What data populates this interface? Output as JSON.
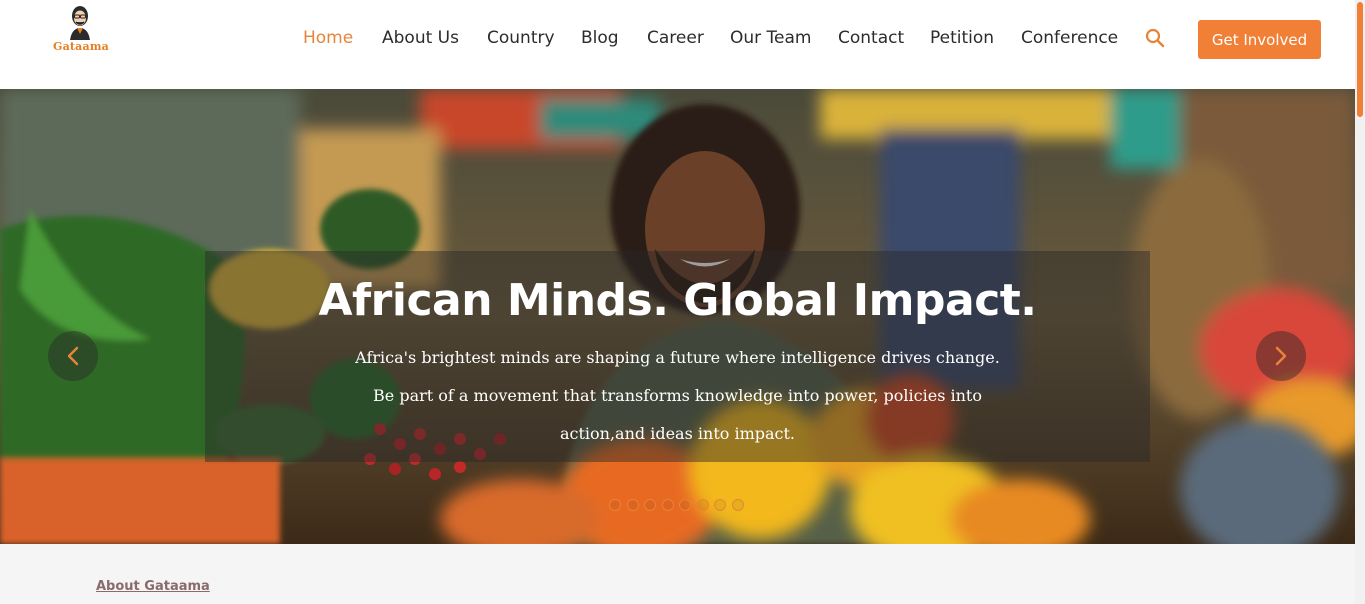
{
  "brand": {
    "name": "Gataama",
    "accent": "#f27f36"
  },
  "nav": {
    "items": [
      {
        "label": "Home",
        "active": true
      },
      {
        "label": "About Us",
        "active": false
      },
      {
        "label": "Country",
        "active": false
      },
      {
        "label": "Blog",
        "active": false
      },
      {
        "label": "Career",
        "active": false
      },
      {
        "label": "Our Team",
        "active": false
      },
      {
        "label": "Contact",
        "active": false
      },
      {
        "label": "Petition",
        "active": false
      },
      {
        "label": "Conference",
        "active": false
      }
    ],
    "search_icon": "search-icon",
    "cta_label": "Get Involved"
  },
  "hero": {
    "title": "African Minds. Global Impact.",
    "subtitle_lines": [
      "Africa's brightest minds are shaping a future where intelligence drives change.",
      "Be part of a movement that transforms knowledge into power, policies into",
      "action,and ideas into impact."
    ],
    "prev_icon": "chevron-left-icon",
    "next_icon": "chevron-right-icon",
    "slide_count": 8,
    "active_slide": 1
  },
  "about": {
    "link_label": "About Gataama"
  }
}
